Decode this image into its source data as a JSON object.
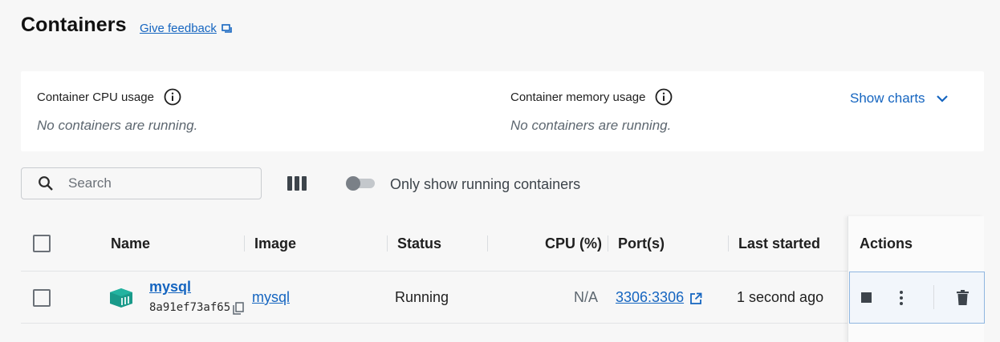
{
  "header": {
    "title": "Containers",
    "feedback_label": "Give feedback"
  },
  "stats": {
    "cpu_label": "Container CPU usage",
    "cpu_empty": "No containers are running.",
    "memory_label": "Container memory usage",
    "memory_empty": "No containers are running.",
    "show_charts_label": "Show charts"
  },
  "toolbar": {
    "search_placeholder": "Search",
    "toggle_label": "Only show running containers",
    "toggle_on": false
  },
  "table": {
    "columns": {
      "name": "Name",
      "image": "Image",
      "status": "Status",
      "cpu": "CPU (%)",
      "ports": "Port(s)",
      "last_started": "Last started",
      "actions": "Actions"
    },
    "rows": [
      {
        "name": "mysql",
        "id": "8a91ef73af65",
        "image": "mysql",
        "status": "Running",
        "cpu": "N/A",
        "ports": "3306:3306",
        "last_started": "1 second ago"
      }
    ]
  },
  "colors": {
    "accent": "#1565c0",
    "container_icon": "#1a9a8a",
    "background": "#f7f7f7",
    "panel": "#ffffff"
  },
  "icons": {
    "feedback": "feedback-icon",
    "info": "info-icon",
    "chevron": "chevron-down-icon",
    "search": "search-icon",
    "columns": "columns-icon",
    "container": "container-icon",
    "copy": "copy-icon",
    "external_link": "external-link-icon",
    "stop": "stop-icon",
    "more": "more-vertical-icon",
    "delete": "trash-icon"
  }
}
